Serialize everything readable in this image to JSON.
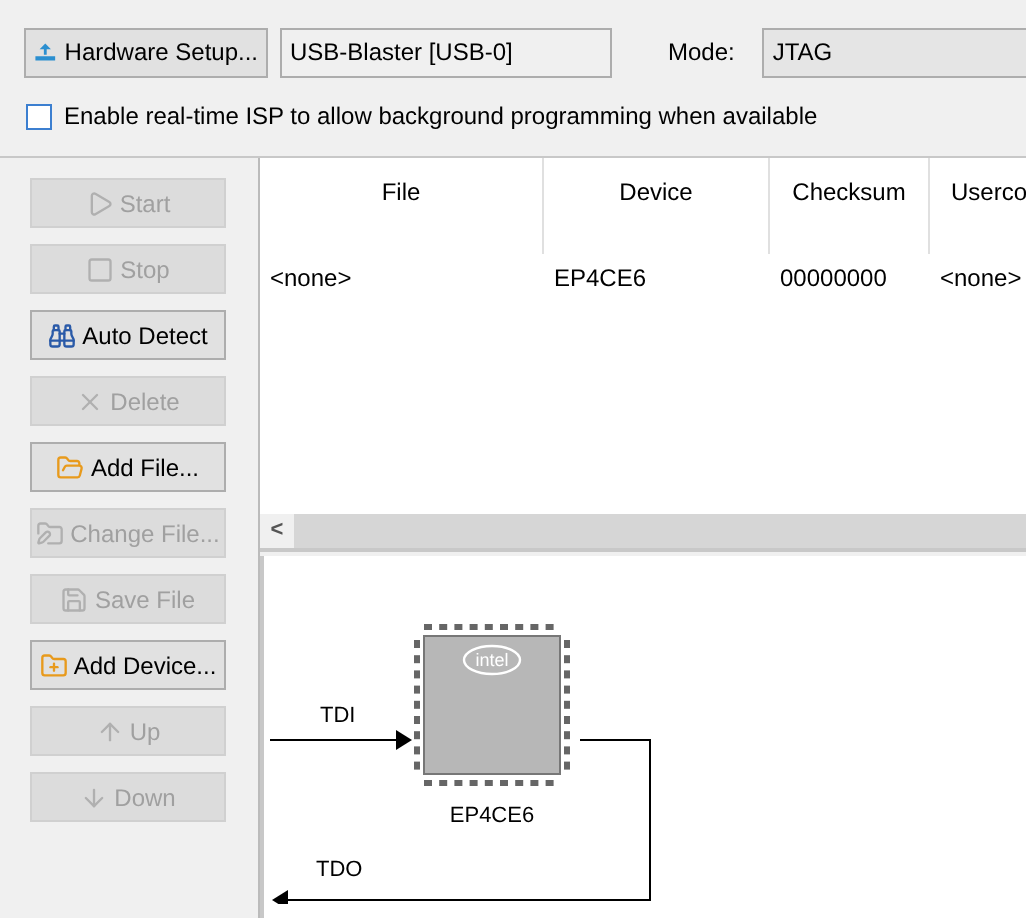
{
  "toolbar": {
    "hardware_button": "Hardware Setup...",
    "hardware_value": "USB-Blaster [USB-0]",
    "mode_label": "Mode:",
    "mode_value": "JTAG"
  },
  "isp_option": {
    "label": "Enable real-time ISP to allow background programming when available",
    "checked": false
  },
  "actions": [
    {
      "label": "Start",
      "kind": "start",
      "disabled": true
    },
    {
      "label": "Stop",
      "kind": "stop",
      "disabled": true
    },
    {
      "label": "Auto Detect",
      "kind": "detect",
      "disabled": false
    },
    {
      "label": "Delete",
      "kind": "delete",
      "disabled": true
    },
    {
      "label": "Add File...",
      "kind": "addfile",
      "disabled": false
    },
    {
      "label": "Change File...",
      "kind": "changefile",
      "disabled": true
    },
    {
      "label": "Save File",
      "kind": "save",
      "disabled": true
    },
    {
      "label": "Add Device...",
      "kind": "adddevice",
      "disabled": false
    },
    {
      "label": "Up",
      "kind": "up",
      "disabled": true
    },
    {
      "label": "Down",
      "kind": "down",
      "disabled": true
    }
  ],
  "table": {
    "columns": [
      "File",
      "Device",
      "Checksum",
      "Userco"
    ],
    "rows": [
      [
        "<none>",
        "EP4CE6",
        "00000000",
        "<none>"
      ]
    ],
    "scroll_left": "<"
  },
  "chain": {
    "tdi": "TDI",
    "tdo": "TDO",
    "device": "EP4CE6",
    "logo": "intel"
  }
}
